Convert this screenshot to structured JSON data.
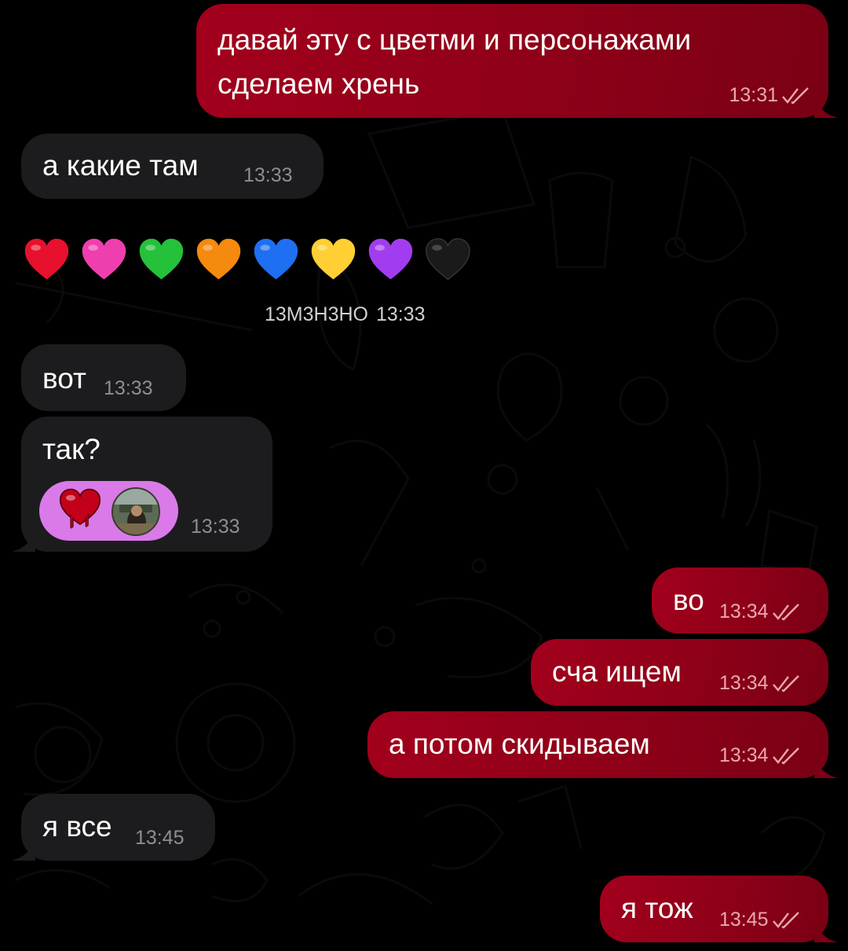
{
  "messages": {
    "m1": {
      "text": "давай эту с цветми и персонажами\nсделаем хрень",
      "time": "13:31"
    },
    "m2": {
      "text": "а какие там",
      "time": "13:33"
    },
    "m3": {
      "caption": "13М3Н3НО",
      "time": "13:33"
    },
    "m4": {
      "text": "вот",
      "time": "13:33"
    },
    "m5": {
      "text": "так?",
      "time": "13:33"
    },
    "m6": {
      "text": "во",
      "time": "13:34"
    },
    "m7": {
      "text": "сча ищем",
      "time": "13:34"
    },
    "m8": {
      "text": "а потом скидываем",
      "time": "13:34"
    },
    "m9": {
      "text": "я все",
      "time": "13:45"
    },
    "m10": {
      "text": "я тож",
      "time": "13:45"
    }
  },
  "hearts": [
    {
      "name": "red-heart",
      "color": "#e8112d"
    },
    {
      "name": "pink-heart",
      "color": "#ef3fae"
    },
    {
      "name": "green-heart",
      "color": "#25c13a"
    },
    {
      "name": "orange-heart",
      "color": "#f58a0e"
    },
    {
      "name": "blue-heart",
      "color": "#1e6ff2"
    },
    {
      "name": "yellow-heart",
      "color": "#ffcf33"
    },
    {
      "name": "purple-heart",
      "color": "#a23cf0"
    },
    {
      "name": "black-heart",
      "color": "#1a1a1a"
    }
  ],
  "colors": {
    "outgoing_bubble": "#8e0018",
    "incoming_bubble": "#1c1c1e",
    "background": "#000000",
    "pill": "#d97ae8"
  },
  "icons": {
    "read_status": "double-check-icon"
  }
}
